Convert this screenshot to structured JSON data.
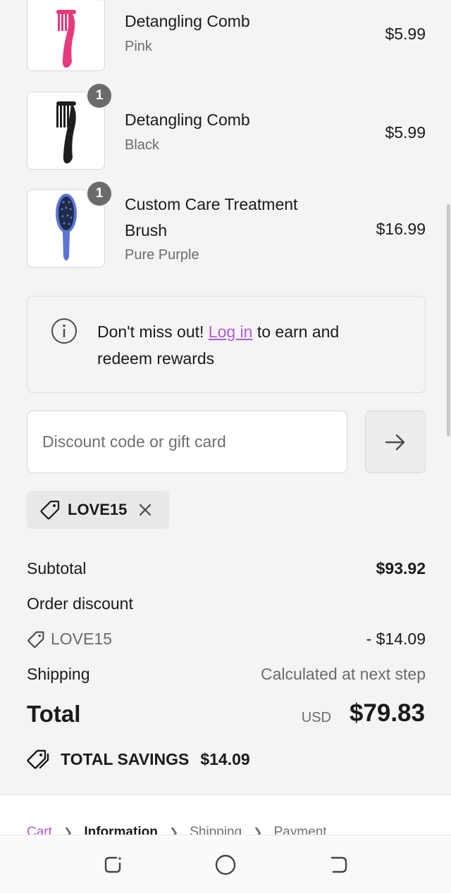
{
  "cart": {
    "items": [
      {
        "name": "Detangling Comb",
        "variant": "Pink",
        "price": "$5.99",
        "quantity": "",
        "color": "#e8397d",
        "icon": "comb-icon"
      },
      {
        "name": "Detangling Comb",
        "variant": "Black",
        "price": "$5.99",
        "quantity": "1",
        "color": "#1e1e1e",
        "icon": "comb-icon"
      },
      {
        "name": "Custom Care Treatment Brush",
        "variant": "Pure Purple",
        "price": "$16.99",
        "quantity": "1",
        "color": "#5b74d8",
        "icon": "brush-icon"
      }
    ]
  },
  "rewards": {
    "text_before": "Don't miss out! ",
    "link_label": "Log in",
    "text_after": " to earn and redeem rewards"
  },
  "discount": {
    "placeholder": "Discount code or gift card",
    "value": "",
    "applied_code": "LOVE15"
  },
  "summary": {
    "subtotal_label": "Subtotal",
    "subtotal_value": "$93.92",
    "order_discount_label": "Order discount",
    "discount_code": "LOVE15",
    "discount_value": "- $14.09",
    "shipping_label": "Shipping",
    "shipping_value": "Calculated at next step",
    "total_label": "Total",
    "currency": "USD",
    "total_value": "$79.83",
    "savings_label": "TOTAL SAVINGS",
    "savings_value": "$14.09"
  },
  "breadcrumb": [
    {
      "label": "Cart",
      "state": "link"
    },
    {
      "label": "Information",
      "state": "current"
    },
    {
      "label": "Shipping",
      "state": "upcoming"
    },
    {
      "label": "Payment",
      "state": "upcoming"
    }
  ],
  "colors": {
    "accent": "#b05cd6",
    "badge": "#6b6b6b",
    "background": "#f4f4f4"
  },
  "system_nav": {
    "icons": [
      "recent-apps-icon",
      "home-icon",
      "back-icon"
    ]
  }
}
